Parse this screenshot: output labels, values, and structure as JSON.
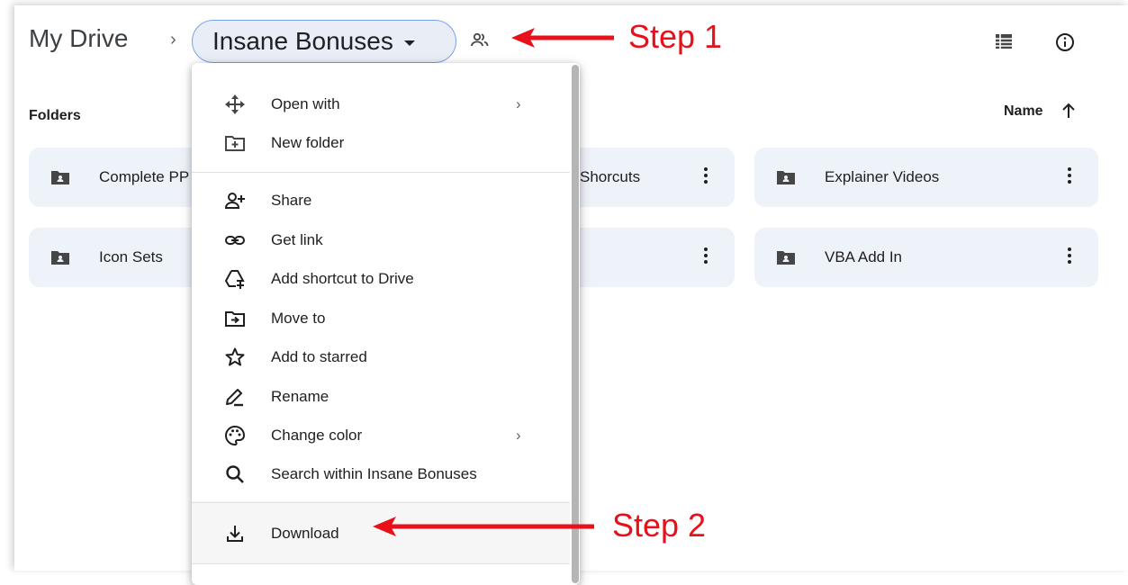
{
  "breadcrumb": {
    "root": "My Drive",
    "separator": "›",
    "current": "Insane Bonuses"
  },
  "annotations": {
    "step1": "Step 1",
    "step2": "Step 2",
    "color": "#e8101b"
  },
  "toolbar": {
    "icons": [
      "list-view-icon",
      "info-icon"
    ]
  },
  "folders_section": {
    "heading": "Folders",
    "sort_label": "Name",
    "sort_direction": "ascending"
  },
  "folders": [
    {
      "name": "Complete PP"
    },
    {
      "name": "Shorcuts"
    },
    {
      "name": "Explainer Videos"
    },
    {
      "name": "Icon Sets"
    },
    {
      "name": ""
    },
    {
      "name": "VBA Add In"
    }
  ],
  "context_menu": {
    "items": [
      {
        "label": "Open with",
        "icon": "move-arrows-icon",
        "submenu": "›"
      },
      {
        "label": "New folder",
        "icon": "new-folder-icon"
      },
      {
        "label": "Share",
        "icon": "person-add-icon"
      },
      {
        "label": "Get link",
        "icon": "link-icon"
      },
      {
        "label": "Add shortcut to Drive",
        "icon": "drive-shortcut-icon"
      },
      {
        "label": "Move to",
        "icon": "move-to-folder-icon"
      },
      {
        "label": "Add to starred",
        "icon": "star-icon"
      },
      {
        "label": "Rename",
        "icon": "rename-pencil-icon"
      },
      {
        "label": "Change color",
        "icon": "palette-icon",
        "submenu": "›"
      },
      {
        "label": "Search within Insane Bonuses",
        "icon": "search-icon"
      },
      {
        "label": "Download",
        "icon": "download-icon"
      }
    ]
  },
  "colors": {
    "folder_card_bg": "#eef2f9",
    "pill_bg": "#e9eef6",
    "pill_border": "#7aa3e6",
    "icon": "#444746"
  }
}
